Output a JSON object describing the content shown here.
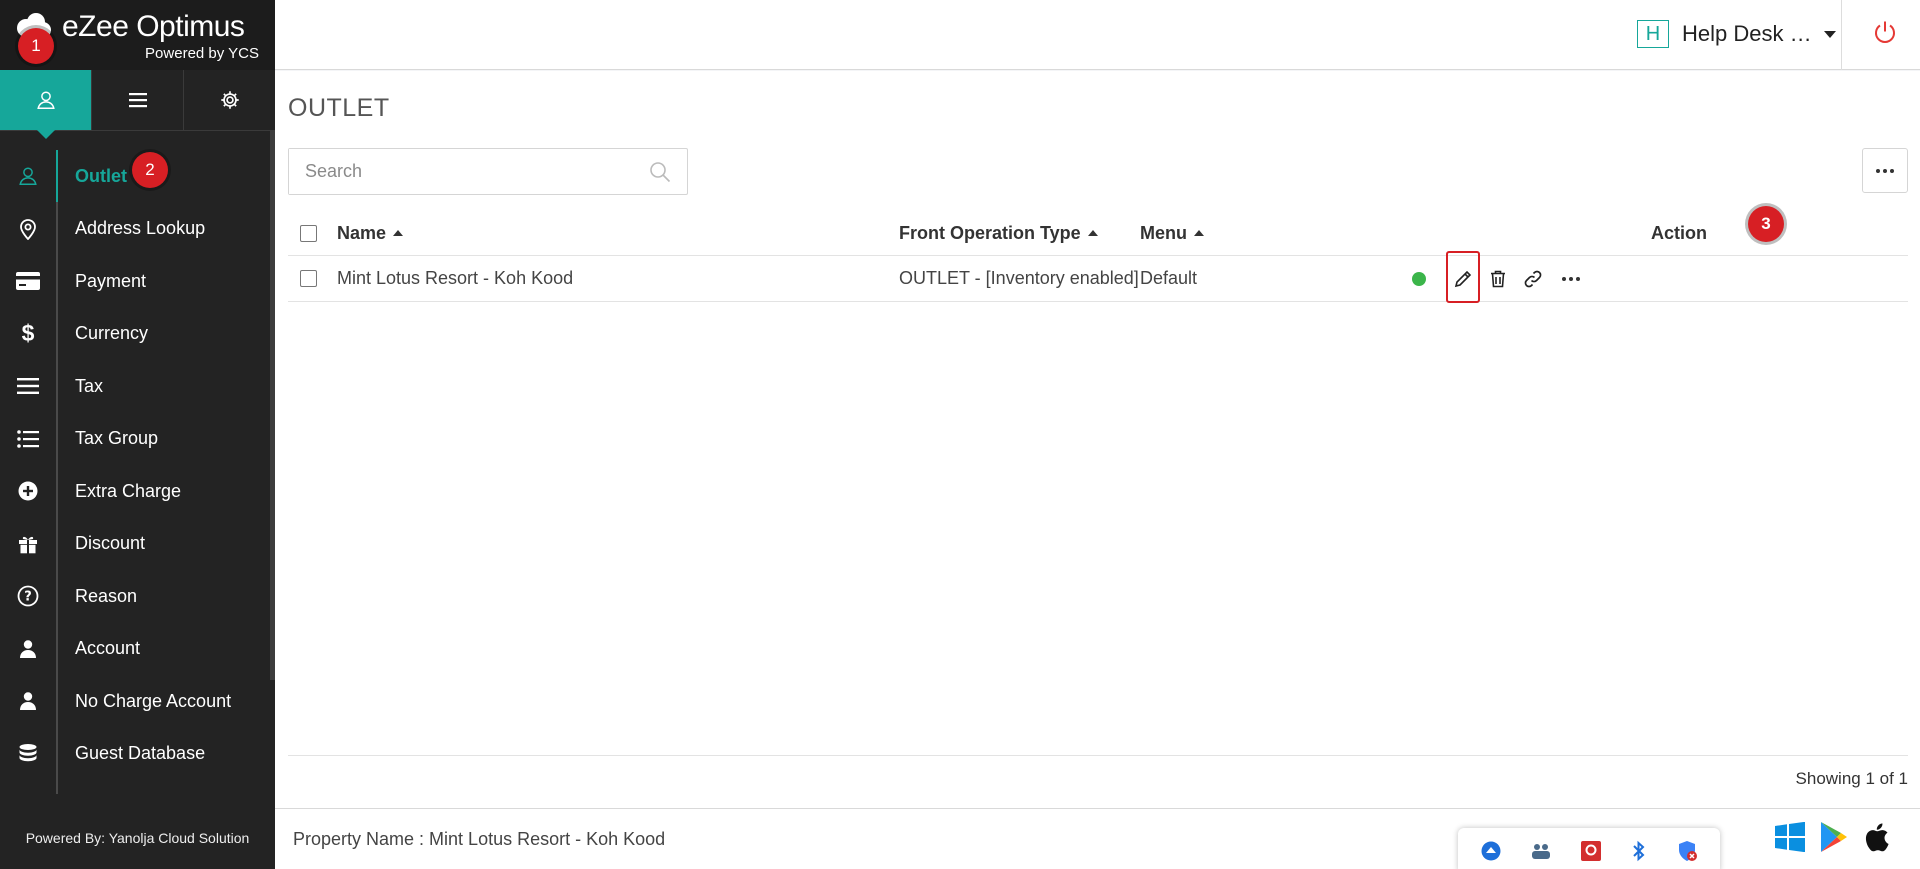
{
  "brand": {
    "name": "eZee Optimus",
    "subtitle": "Powered by YCS"
  },
  "annotations": [
    "1",
    "2",
    "3"
  ],
  "sidebar": {
    "tabs": [
      {
        "icon": "user-icon",
        "active": true
      },
      {
        "icon": "menu-icon",
        "active": false
      },
      {
        "icon": "gear-icon",
        "active": false
      }
    ],
    "items": [
      {
        "label": "Outlet",
        "icon": "user-outline-icon",
        "active": true
      },
      {
        "label": "Address Lookup",
        "icon": "map-pin-icon"
      },
      {
        "label": "Payment",
        "icon": "credit-card-icon"
      },
      {
        "label": "Currency",
        "icon": "dollar-icon"
      },
      {
        "label": "Tax",
        "icon": "bars-icon"
      },
      {
        "label": "Tax Group",
        "icon": "list-icon"
      },
      {
        "label": "Extra Charge",
        "icon": "plus-circle-icon"
      },
      {
        "label": "Discount",
        "icon": "gift-icon"
      },
      {
        "label": "Reason",
        "icon": "question-circle-icon"
      },
      {
        "label": "Account",
        "icon": "person-icon"
      },
      {
        "label": "No Charge Account",
        "icon": "person-icon"
      },
      {
        "label": "Guest Database",
        "icon": "database-icon"
      }
    ],
    "footer": "Powered By: Yanolja Cloud Solution"
  },
  "header": {
    "hotel_initial": "H",
    "hotel_name": "Help Desk …"
  },
  "main": {
    "title": "OUTLET",
    "search_placeholder": "Search",
    "table": {
      "columns": {
        "name": "Name",
        "front_op": "Front Operation Type",
        "menu": "Menu",
        "action": "Action"
      },
      "rows": [
        {
          "name": "Mint Lotus Resort - Koh Kood",
          "front_op": "OUTLET - [Inventory enabled]",
          "menu": "Default",
          "status": "active"
        }
      ]
    },
    "showing": "Showing 1 of 1"
  },
  "bottom": {
    "property_name": "Property Name : Mint Lotus Resort - Koh Kood"
  },
  "colors": {
    "accent": "#16a79a",
    "badge": "#d71f24",
    "status_active": "#3bb54a"
  }
}
